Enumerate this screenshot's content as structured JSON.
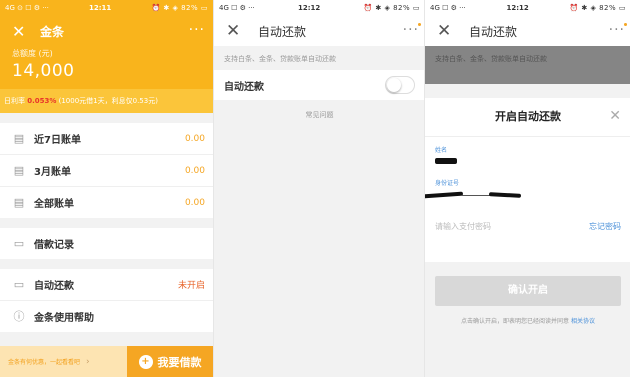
{
  "screen1": {
    "status": {
      "left": "4G  ⊙ ☐ ⚙ ···",
      "time": "12:11",
      "right": "⏰ ✱ ◈ 82% ▭"
    },
    "nav": {
      "close_glyph": "✕",
      "title": "金条",
      "more": "···"
    },
    "quota_label": "总额度 (元)",
    "quota_value": "14,000",
    "rate": {
      "prefix": "日利率 ",
      "rate": "0.053%",
      "suffix": " (1000元借1天，利息仅0.53元)"
    },
    "rows_a": [
      {
        "label": "近7日账单",
        "value": "0.00",
        "icon": "doc-icon",
        "glyph": "▤"
      },
      {
        "label": "3月账单",
        "value": "0.00",
        "icon": "doc-icon",
        "glyph": "▤"
      },
      {
        "label": "全部账单",
        "value": "0.00",
        "icon": "doc-icon",
        "glyph": "▤"
      }
    ],
    "rows_b": [
      {
        "label": "借款记录",
        "icon": "record-icon",
        "glyph": "▭"
      }
    ],
    "rows_c": [
      {
        "label": "自动还款",
        "value": "未开启",
        "icon": "card-icon",
        "glyph": "▭"
      },
      {
        "label": "金条使用帮助",
        "icon": "help-icon",
        "glyph": "ⓘ"
      }
    ],
    "bottom": {
      "promo": "金条有何优惠，一起看看吧",
      "chevron": "›",
      "borrow": "我要借款",
      "borrow_icon": "+"
    }
  },
  "screen2": {
    "status": {
      "left": "4G  ☐ ⚙ ···",
      "time": "12:12",
      "right": "⏰ ✱ ◈ 82% ▭"
    },
    "nav": {
      "close_glyph": "✕",
      "title": "自动还款",
      "more": "···"
    },
    "hint": "支持白条、金条、贷款账单自动还款",
    "toggle_label": "自动还款",
    "faq": "常见问题"
  },
  "screen3": {
    "status": {
      "left": "4G  ☐ ⚙ ···",
      "time": "12:12",
      "right": "⏰ ✱ ◈ 82% ▭"
    },
    "nav": {
      "close_glyph": "✕",
      "title": "自动还款",
      "more": "···"
    },
    "hint": "支持白条、金条、贷款账单自动还款",
    "sheet_title": "开启自动还款",
    "sheet_close": "✕",
    "name_label": "姓名",
    "id_label": "身份证号",
    "pwd_placeholder": "请输入支付密码",
    "forgot": "忘记密码",
    "confirm": "确认开启",
    "agree_prefix": "点击确认开启，即表明您已经阅读并同意 ",
    "agree_link": "相关协议"
  },
  "colors": {
    "brand_orange": "#f9b41c",
    "link_blue": "#4a90d9",
    "alert_red": "#e8352b"
  }
}
